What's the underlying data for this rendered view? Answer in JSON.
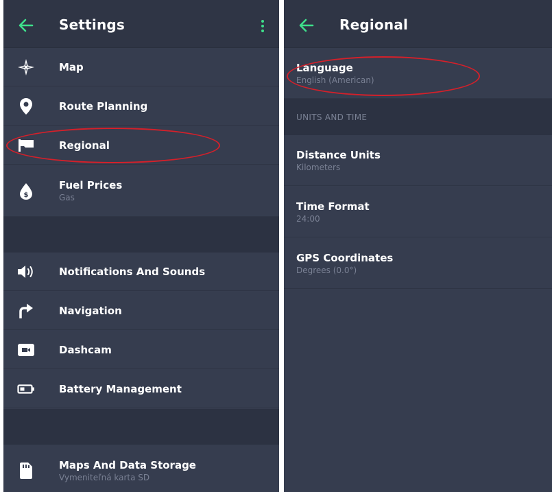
{
  "left": {
    "title": "Settings",
    "items_group1": [
      {
        "label": "Map",
        "icon": "compass-rose-icon"
      },
      {
        "label": "Route Planning",
        "icon": "location-pin-icon"
      },
      {
        "label": "Regional",
        "icon": "flag-icon"
      },
      {
        "label": "Fuel Prices",
        "sub": "Gas",
        "icon": "fuel-drop-icon"
      }
    ],
    "items_group2": [
      {
        "label": "Notifications And Sounds",
        "icon": "speaker-icon"
      },
      {
        "label": "Navigation",
        "icon": "turn-arrow-icon"
      },
      {
        "label": "Dashcam",
        "icon": "camera-icon"
      },
      {
        "label": "Battery Management",
        "icon": "battery-icon"
      }
    ],
    "items_group3": [
      {
        "label": "Maps And Data Storage",
        "sub": "Vymeniteľná karta SD",
        "icon": "sd-card-icon"
      }
    ]
  },
  "right": {
    "title": "Regional",
    "language": {
      "label": "Language",
      "value": "English (American)"
    },
    "section_header": "UNITS AND TIME",
    "items": [
      {
        "label": "Distance Units",
        "value": "Kilometers"
      },
      {
        "label": "Time Format",
        "value": "24:00"
      },
      {
        "label": "GPS Coordinates",
        "value": "Degrees (0.0°)"
      }
    ]
  },
  "colors": {
    "accent": "#3ee08b",
    "panel_bg": "#363d4f",
    "topbar_bg": "#2f3545",
    "section_bg": "#2c3242",
    "annotation": "#d4202a"
  }
}
